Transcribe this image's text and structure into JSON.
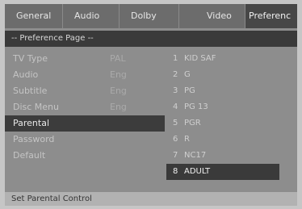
{
  "tabs": [
    {
      "label": "General"
    },
    {
      "label": "Audio"
    },
    {
      "label": "Dolby"
    },
    {
      "label": "Video"
    },
    {
      "label": "Preferenc"
    }
  ],
  "page_title": "-- Preference Page --",
  "menu": [
    {
      "label": "TV Type",
      "value": "PAL"
    },
    {
      "label": "Audio",
      "value": "Eng"
    },
    {
      "label": "Subtitle",
      "value": "Eng"
    },
    {
      "label": "Disc Menu",
      "value": "Eng"
    },
    {
      "label": "Parental",
      "value": ""
    },
    {
      "label": "Password",
      "value": ""
    },
    {
      "label": "Default",
      "value": ""
    }
  ],
  "parental_options": [
    {
      "num": "1",
      "label": "KID SAF"
    },
    {
      "num": "2",
      "label": "G"
    },
    {
      "num": "3",
      "label": "PG"
    },
    {
      "num": "4",
      "label": "PG 13"
    },
    {
      "num": "5",
      "label": "PGR"
    },
    {
      "num": "6",
      "label": "R"
    },
    {
      "num": "7",
      "label": "NC17"
    },
    {
      "num": "8",
      "label": "ADULT"
    }
  ],
  "status": "Set Parental Control"
}
